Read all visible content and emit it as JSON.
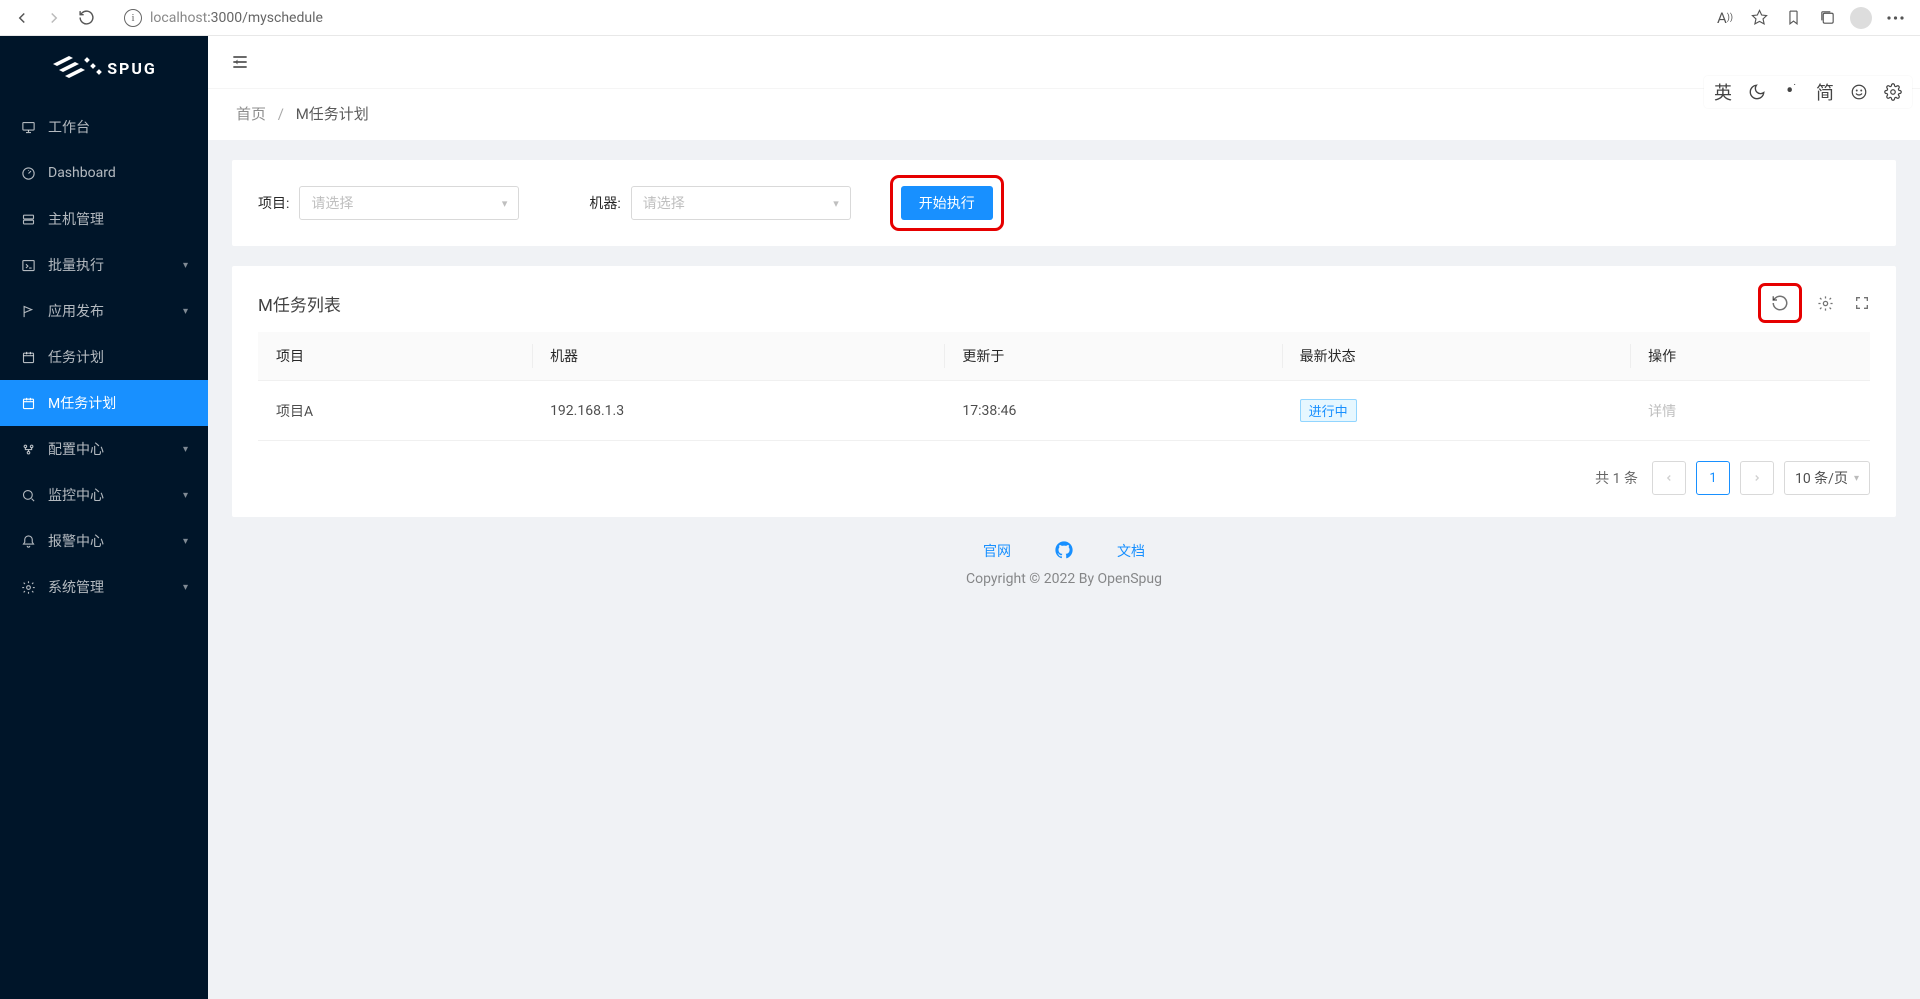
{
  "browser": {
    "url_host": "localhost",
    "url_path": ":3000/myschedule",
    "ext_lang": "英",
    "ext_simp": "简"
  },
  "sidebar": {
    "brand": "SPUG",
    "items": [
      {
        "label": "工作台"
      },
      {
        "label": "Dashboard"
      },
      {
        "label": "主机管理"
      },
      {
        "label": "批量执行",
        "expandable": true
      },
      {
        "label": "应用发布",
        "expandable": true
      },
      {
        "label": "任务计划"
      },
      {
        "label": "M任务计划",
        "active": true
      },
      {
        "label": "配置中心",
        "expandable": true
      },
      {
        "label": "监控中心",
        "expandable": true
      },
      {
        "label": "报警中心",
        "expandable": true
      },
      {
        "label": "系统管理",
        "expandable": true
      }
    ]
  },
  "breadcrumb": {
    "home": "首页",
    "current": "M任务计划"
  },
  "filter": {
    "project_label": "项目:",
    "project_placeholder": "请选择",
    "machine_label": "机器:",
    "machine_placeholder": "请选择",
    "run_button": "开始执行"
  },
  "list": {
    "title": "M任务列表",
    "columns": {
      "project": "项目",
      "machine": "机器",
      "updated_at": "更新于",
      "status": "最新状态",
      "actions": "操作"
    },
    "rows": [
      {
        "project": "项目A",
        "machine": "192.168.1.3",
        "updated_at": "17:38:46",
        "status": "进行中",
        "action": "详情"
      }
    ]
  },
  "pagination": {
    "total_text": "共 1 条",
    "page": "1",
    "size_label": "10 条/页"
  },
  "footer": {
    "link_site": "官网",
    "link_docs": "文档",
    "copyright": "Copyright © 2022 By OpenSpug"
  }
}
